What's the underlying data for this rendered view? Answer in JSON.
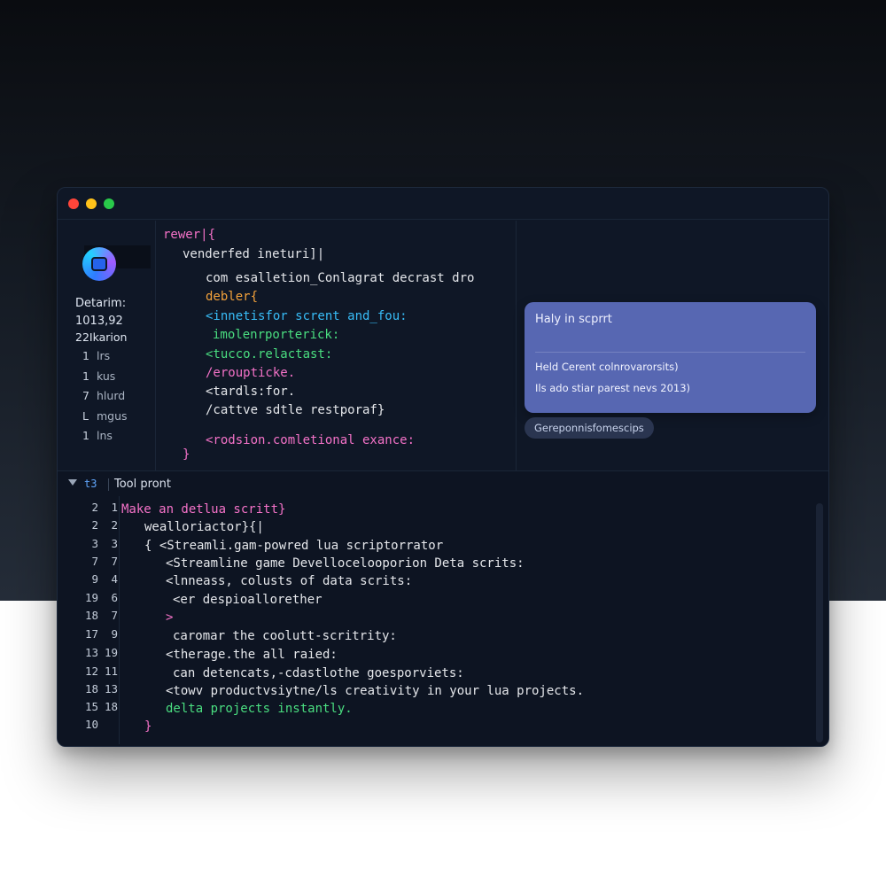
{
  "sidebar": {
    "name": "Detarim:",
    "number": "1013,92",
    "sub": "22Ikarion",
    "items": [
      {
        "num": "1",
        "label": "lrs"
      },
      {
        "num": "1",
        "label": "kus"
      },
      {
        "num": "7",
        "label": "hlurd"
      },
      {
        "num": "L",
        "label": "mgus"
      },
      {
        "num": "1",
        "label": "lns"
      }
    ]
  },
  "editor_top": {
    "lines": [
      {
        "text": "rewer|{",
        "color": "kw"
      },
      {
        "text": "venderfed ineturi]|",
        "color": "wt"
      },
      {
        "text": "com esalletion_Conlagrat decrast dro",
        "color": "wt"
      },
      {
        "text": "debler{",
        "color": "or"
      },
      {
        "text": "<innetisfor scrent and_fou:",
        "color": "cy"
      },
      {
        "text": "imolenrporterick:",
        "color": "gr"
      },
      {
        "text": "<tucco.relactast:",
        "color": "gr"
      },
      {
        "text": "/eroupticke.",
        "color": "kw"
      },
      {
        "text": "<tardls:for.",
        "color": "wt"
      },
      {
        "text": "/cattve sdtle restporaf}",
        "color": "wt"
      },
      {
        "text": "<rodsion.comletional exance:",
        "color": "kw"
      },
      {
        "text": "}",
        "color": "kw"
      }
    ]
  },
  "chat": {
    "title": "Haly in scprrt",
    "lines": [
      "Held Cerent colnrovarorsits)",
      "Ils ado stiar parest nevs 2013)"
    ],
    "chip": "Gereponnisfomescips"
  },
  "bottom": {
    "tag": "t3",
    "title": "Tool pront",
    "gutter": [
      [
        "2",
        "1"
      ],
      [
        "2",
        "2"
      ],
      [
        "3",
        "3"
      ],
      [
        "7",
        "7"
      ],
      [
        "9",
        "4"
      ],
      [
        "19",
        "6"
      ],
      [
        "18",
        "7"
      ],
      [
        "17",
        "9"
      ],
      [
        "13",
        "19"
      ],
      [
        "12",
        "11"
      ],
      [
        "18",
        "13"
      ],
      [
        "15",
        "18"
      ],
      [
        "10",
        ""
      ]
    ],
    "lines": [
      {
        "text": "Make an detlua scritt}",
        "color": "kw"
      },
      {
        "text": "wealloriactor}{|",
        "color": "wt"
      },
      {
        "text": "{   <Streamli.gam-powred lua scriptorrator",
        "color": "wt"
      },
      {
        "text": "<Streamline game Devellocelooporion Deta scrits:",
        "color": "wt"
      },
      {
        "text": "<lnneass, colusts of data scrits:",
        "color": "wt"
      },
      {
        "text": "<er despioallorether",
        "color": "wt"
      },
      {
        "text": ">",
        "color": "kw"
      },
      {
        "text": "caromar the coolutt-scritrity:",
        "color": "wt"
      },
      {
        "text": "<therage.the all raied:",
        "color": "wt"
      },
      {
        "text": "can detencats,-cdastlothe goesporviets:",
        "color": "wt"
      },
      {
        "text": "<towv productvsiytne/ls creativity in your lua projects.",
        "color": "wt"
      },
      {
        "text": "delta projects instantly.",
        "color": "gr"
      },
      {
        "text": "}",
        "color": "kw"
      }
    ]
  },
  "colors": {
    "window_bg": "#0f1726",
    "chat_card": "#5767b2",
    "keyword": "#f472c8",
    "string": "#4ade80",
    "accent_orange": "#f4a23b",
    "accent_cyan": "#38bdf8"
  }
}
